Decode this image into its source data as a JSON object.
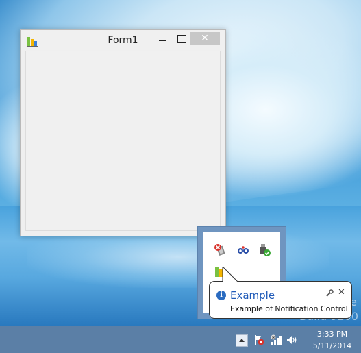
{
  "window": {
    "title": "Form1",
    "close_glyph": "✕",
    "icon": "bar-chart-icon"
  },
  "watermark": {
    "line1": "e",
    "line2": "Build 9200"
  },
  "tray": {
    "icons": [
      "hardware-error-icon",
      "network-sync-icon",
      "usb-safe-remove-icon",
      "bar-chart-icon"
    ]
  },
  "balloon": {
    "title": "Example",
    "text": "Example of Notification Control",
    "close_glyph": "✕",
    "info_glyph": "i"
  },
  "taskbar": {
    "time": "3:33 PM",
    "date": "5/11/2014",
    "icons": [
      "action-center-flag-icon",
      "network-icon",
      "volume-icon"
    ]
  },
  "colors": {
    "accent": "#1f5ab8",
    "taskbar": "#5b7fa6",
    "close_button": "#c7c7c7"
  }
}
